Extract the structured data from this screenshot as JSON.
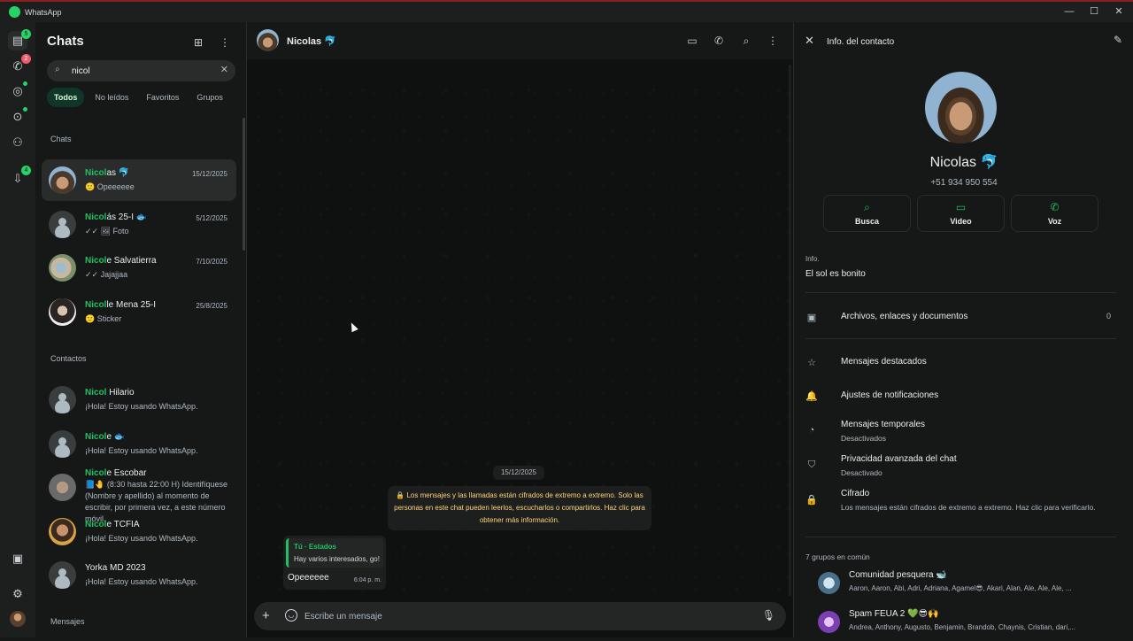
{
  "window": {
    "title": "WhatsApp",
    "min": "—",
    "max": "☐",
    "close": "✕"
  },
  "rail": {
    "chats_badge": "5",
    "calls_badge": "2",
    "updates_badge": "4"
  },
  "list": {
    "title": "Chats",
    "search_value": "nicol",
    "filters": [
      "Todos",
      "No leídos",
      "Favoritos",
      "Grupos"
    ],
    "section_chats": "Chats",
    "section_contacts": "Contactos",
    "section_messages": "Mensajes",
    "chats": [
      {
        "hl": "Nicol",
        "rest": "as 🐬",
        "date": "15/12/2025",
        "sub": "🙂 Opeeeeee"
      },
      {
        "hl": "Nicol",
        "rest": "ás 25-I 🐟",
        "date": "5/12/2025",
        "sub": "✓✓ 🖼 Foto"
      },
      {
        "hl": "Nicol",
        "rest": "e Salvatierra",
        "date": "7/10/2025",
        "sub": "✓✓ Jajajjaa"
      },
      {
        "hl": "Nicol",
        "rest": "le Mena 25-I",
        "date": "25/8/2025",
        "sub": "🙂 Sticker"
      }
    ],
    "contacts": [
      {
        "hl": "Nicol",
        "rest": " Hilario",
        "sub": "¡Hola! Estoy usando WhatsApp."
      },
      {
        "hl": "Nicol",
        "rest": "e 🐟",
        "sub": "¡Hola! Estoy usando WhatsApp."
      },
      {
        "hl": "Nicol",
        "rest": "e Escobar",
        "sub": "📘🤚 (8:30 hasta 22:00 H) Identifíquese (Nombre y apellido) al momento de escribir, por primera vez, a este número móvil."
      },
      {
        "hl": "Nicol",
        "rest": "e TCFIA",
        "sub": "¡Hola! Estoy usando WhatsApp."
      },
      {
        "hl": "",
        "rest": "Yorka MD 2023",
        "sub": "¡Hola! Estoy usando WhatsApp."
      }
    ]
  },
  "chat": {
    "name": "Nicolas 🐬",
    "date_pill": "15/12/2025",
    "encryption": "🔒 Los mensajes y las llamadas están cifrados de extremo a extremo. Solo las personas en este chat pueden leerlos, escucharlos o compartirlos. Haz clic para obtener más información.",
    "quote_author": "Tú · Estados",
    "quote_text": "Hay varios interesados, go!",
    "message": "Opeeeeee",
    "time": "6:04 p. m.",
    "composer_placeholder": "Escribe un mensaje"
  },
  "info": {
    "header": "Info. del contacto",
    "name": "Nicolas 🐬",
    "phone": "+51 934 950 554",
    "actions": [
      "Busca",
      "Video",
      "Voz"
    ],
    "about_label": "Info.",
    "about": "El sol es bonito",
    "files": "Archivos, enlaces y documentos",
    "files_count": "0",
    "starred": "Mensajes destacados",
    "notifications": "Ajustes de notificaciones",
    "temp": "Mensajes temporales",
    "temp_sub": "Desactivados",
    "privacy": "Privacidad avanzada del chat",
    "privacy_sub": "Desactivado",
    "cipher": "Cifrado",
    "cipher_sub": "Los mensajes están cifrados de extremo a extremo. Haz clic para verificarlo.",
    "groups_head": "7 grupos en común",
    "groups": [
      {
        "name": "Comunidad pesquera 🐋",
        "members": "Aaron, Aaron, Abi, Adri, Adriana, Agamel😎, Akari, Alan, Ale, Ale, Ale, ..."
      },
      {
        "name": "Spam FEUA 2 💚😎🙌",
        "members": "Andrea, Anthony, Augusto, Benjamin, Brandob, Chaynis, Cristian, dari,..."
      }
    ]
  },
  "colors": {
    "accent": "#21c063",
    "badge": "#25d366",
    "panel": "#161717",
    "wallpaper": "#0f1111"
  }
}
